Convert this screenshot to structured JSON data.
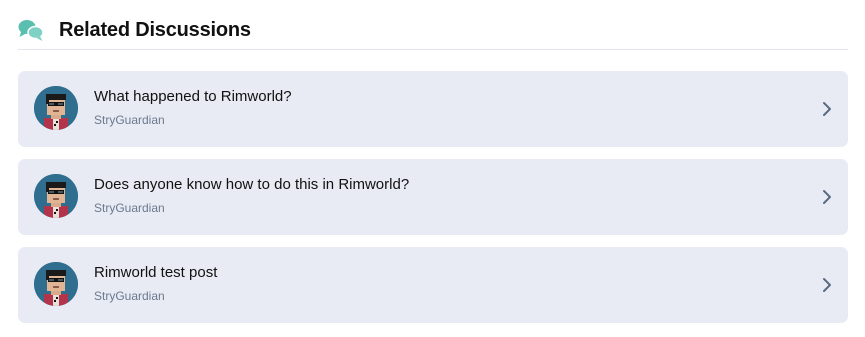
{
  "header": {
    "icon": "chat-bubbles-icon",
    "title": "Related Discussions",
    "icon_color": "#5bbfb0"
  },
  "discussions": [
    {
      "title": "What happened to Rimworld?",
      "author": "StryGuardian",
      "avatar": "pixel-character-avatar"
    },
    {
      "title": "Does anyone know how to do this in Rimworld?",
      "author": "StryGuardian",
      "avatar": "pixel-character-avatar"
    },
    {
      "title": "Rimworld test post",
      "author": "StryGuardian",
      "avatar": "pixel-character-avatar"
    }
  ],
  "colors": {
    "card_background": "#e8ebf3",
    "author_text": "#6b7a8f",
    "chevron": "#5a6a80"
  }
}
